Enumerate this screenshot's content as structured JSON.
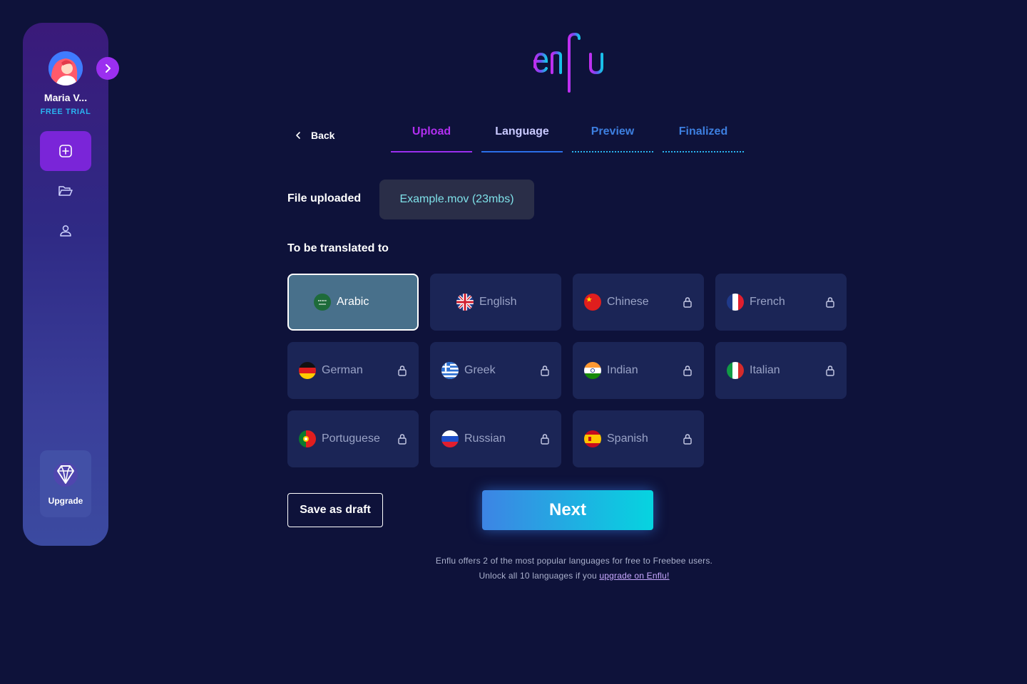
{
  "sidebar": {
    "user_name": "Maria V...",
    "plan": "FREE TRIAL",
    "upgrade_label": "Upgrade",
    "nav_icons": [
      "plus-square-icon",
      "folder-open-icon",
      "user-icon"
    ]
  },
  "logo": {
    "text": "enflu"
  },
  "steps": {
    "back_label": "Back",
    "tabs": [
      "Upload",
      "Language",
      "Preview",
      "Finalized"
    ]
  },
  "file": {
    "label": "File uploaded",
    "value": "Example.mov (23mbs)"
  },
  "translate": {
    "label": "To be translated to",
    "languages": [
      {
        "name": "Arabic",
        "selected": true,
        "locked": false
      },
      {
        "name": "English",
        "selected": false,
        "locked": false
      },
      {
        "name": "Chinese",
        "selected": false,
        "locked": true
      },
      {
        "name": "French",
        "selected": false,
        "locked": true
      },
      {
        "name": "German",
        "selected": false,
        "locked": true
      },
      {
        "name": "Greek",
        "selected": false,
        "locked": true
      },
      {
        "name": "Indian",
        "selected": false,
        "locked": true
      },
      {
        "name": "Italian",
        "selected": false,
        "locked": true
      },
      {
        "name": "Portuguese",
        "selected": false,
        "locked": true
      },
      {
        "name": "Russian",
        "selected": false,
        "locked": true
      },
      {
        "name": "Spanish",
        "selected": false,
        "locked": true
      }
    ]
  },
  "actions": {
    "draft_label": "Save as draft",
    "next_label": "Next"
  },
  "footnote": {
    "line1": "Enflu offers 2 of the most popular languages for free to Freebee users.",
    "line2_prefix": "Unlock all 10 languages if you ",
    "line2_link": "upgrade on Enflu!"
  },
  "colors": {
    "background": "#0e123a",
    "accent_purple": "#9b2ff0",
    "accent_cyan": "#06d4e0",
    "card": "#1b2556",
    "selected_card": "#48708b"
  }
}
